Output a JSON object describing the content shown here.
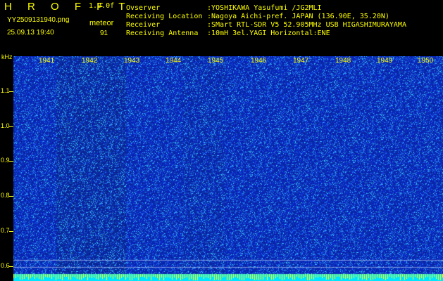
{
  "header": {
    "app_title": "H R O F F T",
    "version": "1.0.0f",
    "file_name": "YY2509131940.png",
    "datetime": "25.09.13 19:40",
    "mode_label": "meteor",
    "mode_count": "91"
  },
  "info": [
    {
      "key": "Ovserver",
      "value": ":YOSHIKAWA Yasufumi /JG2MLI"
    },
    {
      "key": "Receiving Location",
      "value": ":Nagoya Aichi-pref. JAPAN (136.90E, 35.20N)"
    },
    {
      "key": "Receiver",
      "value": ":SMart RTL-SDR V5 52.905MHz USB HIGASHIMURAYAMA"
    },
    {
      "key": "Receiving Antenna",
      "value": ":10mH 3el.YAGI Horizontal:ENE"
    }
  ],
  "axis": {
    "y_unit": "kHz",
    "y_ticks": [
      "1.1",
      "1.0",
      "0.9",
      "0.8",
      "0.7",
      "0.6"
    ],
    "x_ticks": [
      "1941",
      "1942",
      "1943",
      "1944",
      "1945",
      "1946",
      "1947",
      "1948",
      "1949",
      "1950"
    ]
  },
  "colors": {
    "background": "#000000",
    "text": "#ffff00",
    "spectrum_base": "#1428c8",
    "spectrum_noise": "#3ab8ff",
    "baseline_band": "#00e5ff"
  }
}
